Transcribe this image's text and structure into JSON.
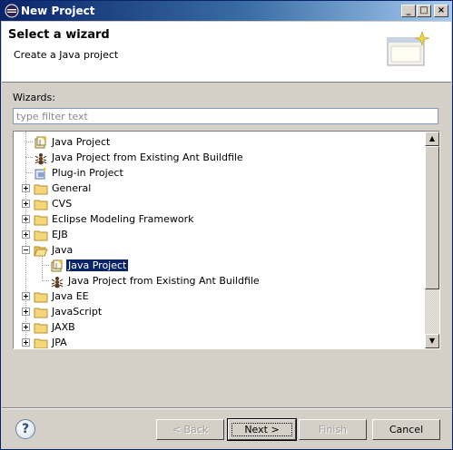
{
  "window": {
    "title": "New Project"
  },
  "header": {
    "title": "Select a wizard",
    "description": "Create a Java project"
  },
  "wizards_label": "Wizards:",
  "filter": {
    "placeholder": "type filter text",
    "value": ""
  },
  "tree": {
    "items": [
      {
        "label": "Java Project",
        "icon": "java-project-icon",
        "selected": false
      },
      {
        "label": "Java Project from Existing Ant Buildfile",
        "icon": "ant-icon",
        "selected": false
      },
      {
        "label": "Plug-in Project",
        "icon": "plugin-project-icon",
        "selected": false
      },
      {
        "label": "General",
        "icon": "folder-icon",
        "expanded": false
      },
      {
        "label": "CVS",
        "icon": "folder-icon",
        "expanded": false
      },
      {
        "label": "Eclipse Modeling Framework",
        "icon": "folder-icon",
        "expanded": false
      },
      {
        "label": "EJB",
        "icon": "folder-icon",
        "expanded": false
      },
      {
        "label": "Java",
        "icon": "folder-open-icon",
        "expanded": true
      },
      {
        "label": "Java Project",
        "icon": "java-project-icon",
        "selected": true
      },
      {
        "label": "Java Project from Existing Ant Buildfile",
        "icon": "ant-icon",
        "selected": false
      },
      {
        "label": "Java EE",
        "icon": "folder-icon",
        "expanded": false
      },
      {
        "label": "JavaScript",
        "icon": "folder-icon",
        "expanded": false
      },
      {
        "label": "JAXB",
        "icon": "folder-icon",
        "expanded": false
      },
      {
        "label": "JPA",
        "icon": "folder-icon",
        "expanded": false
      }
    ]
  },
  "buttons": {
    "back": "< Back",
    "next": "Next >",
    "finish": "Finish",
    "cancel": "Cancel"
  },
  "help": {
    "glyph": "?"
  },
  "titlebar_buttons": {
    "minimize": "_",
    "maximize": "□",
    "close": "×"
  },
  "colors": {
    "selection": "#0a246a",
    "titlebar": "#0a246a",
    "dialog_bg": "#d4d0c8"
  }
}
